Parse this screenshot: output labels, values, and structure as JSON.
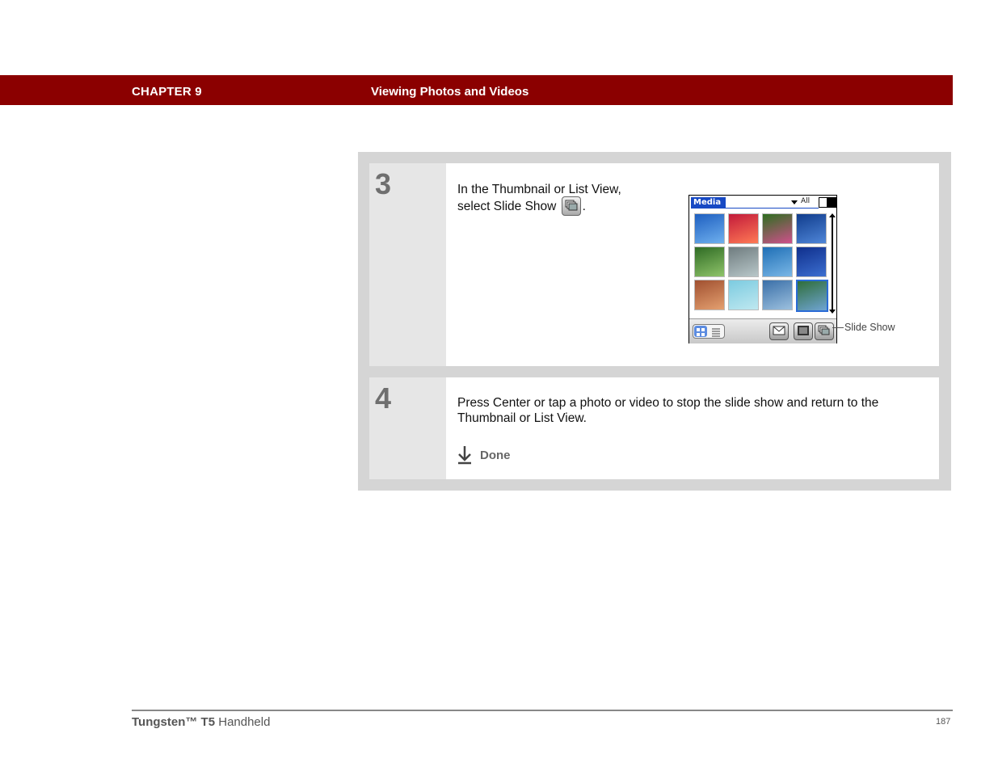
{
  "header": {
    "chapter": "CHAPTER 9",
    "title": "Viewing Photos and Videos",
    "bg_color": "#8b0000"
  },
  "steps": [
    {
      "number": "3",
      "text_line1": "In the Thumbnail or List View,",
      "text_line2": "select Slide Show",
      "text_tail": ".",
      "inline_icon": "slide-show-icon"
    },
    {
      "number": "4",
      "text": "Press Center or tap a photo or video to stop the slide show and return to the Thumbnail or List View.",
      "done_label": "Done",
      "done_icon": "done-arrow-icon"
    }
  ],
  "device_screen": {
    "app_title": "Media",
    "category": "All",
    "thumbnails": [
      {
        "name": "sky",
        "colors": [
          "#1e5fc0",
          "#6fb0ee"
        ]
      },
      {
        "name": "sunset",
        "colors": [
          "#c21a3a",
          "#ff7a55"
        ]
      },
      {
        "name": "flowers",
        "colors": [
          "#2d6e1f",
          "#d0508c"
        ]
      },
      {
        "name": "water",
        "colors": [
          "#103c8c",
          "#4f86d8"
        ]
      },
      {
        "name": "trees",
        "colors": [
          "#2f6b24",
          "#8fc46a"
        ]
      },
      {
        "name": "branches",
        "colors": [
          "#6f7c7f",
          "#b8c7c9"
        ]
      },
      {
        "name": "lake",
        "colors": [
          "#1f6fb6",
          "#7ab7e6"
        ]
      },
      {
        "name": "person",
        "colors": [
          "#0f2f8c",
          "#3c6fd0"
        ]
      },
      {
        "name": "friends",
        "colors": [
          "#a05030",
          "#e4a070"
        ]
      },
      {
        "name": "beach",
        "colors": [
          "#7ccbe0",
          "#bfe8f0"
        ]
      },
      {
        "name": "ocean",
        "colors": [
          "#3a6fa8",
          "#9cc0de"
        ]
      },
      {
        "name": "hills",
        "colors": [
          "#2f6e3a",
          "#6fa4d4"
        ]
      }
    ],
    "selected_index": 11,
    "toolbar_icons": [
      "thumbnail-view-icon",
      "list-view-icon",
      "send-icon",
      "details-icon",
      "slide-show-icon"
    ]
  },
  "callout": {
    "label": "Slide Show"
  },
  "footer": {
    "product_bold": "Tungsten™ T5",
    "product_rest": " Handheld",
    "page_number": "187"
  }
}
